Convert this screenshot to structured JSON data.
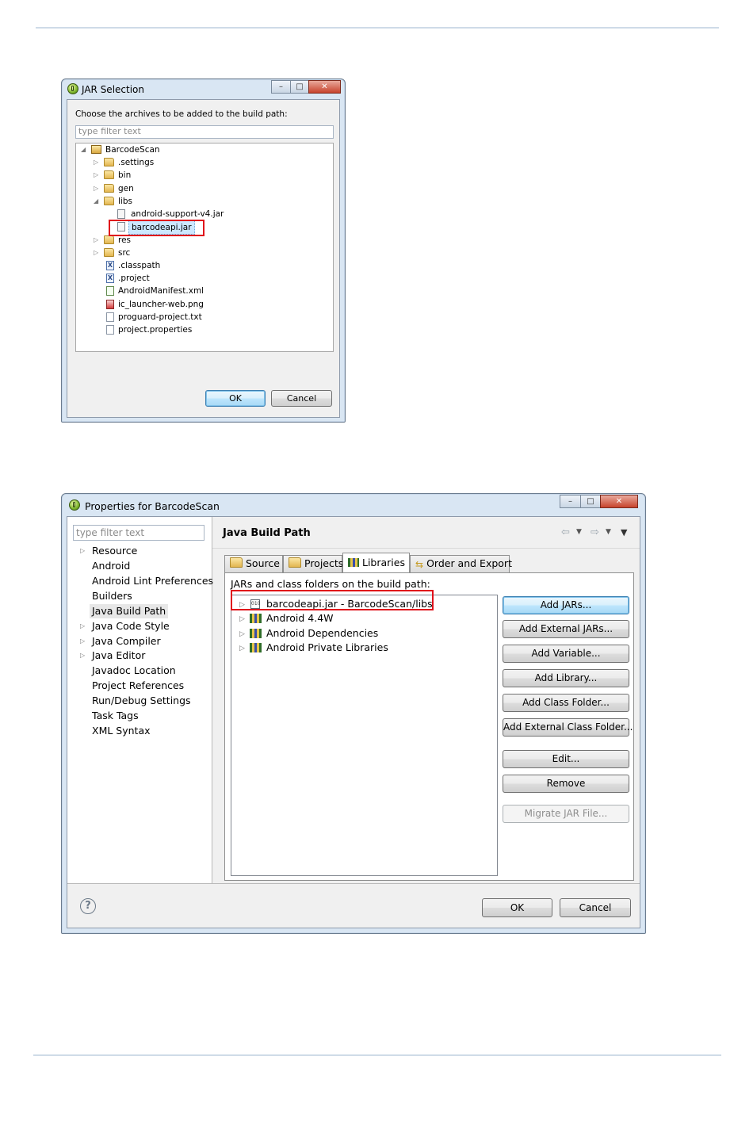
{
  "jar_dialog": {
    "title": "JAR Selection",
    "instruction": "Choose the archives to be added to the build path:",
    "filter_placeholder": "type filter text",
    "tree": {
      "root": "BarcodeScan",
      "settings": ".settings",
      "bin": "bin",
      "gen": "gen",
      "libs": "libs",
      "support_jar": "android-support-v4.jar",
      "barcode_jar": "barcodeapi.jar",
      "res": "res",
      "src": "src",
      "classpath": ".classpath",
      "project": ".project",
      "manifest": "AndroidManifest.xml",
      "launcher": "ic_launcher-web.png",
      "proguard": "proguard-project.txt",
      "properties": "project.properties"
    },
    "ok_label": "OK",
    "cancel_label": "Cancel"
  },
  "props_dialog": {
    "title": "Properties for BarcodeScan",
    "filter_placeholder": "type filter text",
    "nav": {
      "resource": "Resource",
      "android": "Android",
      "lint": "Android Lint Preferences",
      "builders": "Builders",
      "build_path": "Java Build Path",
      "code_style": "Java Code Style",
      "compiler": "Java Compiler",
      "editor": "Java Editor",
      "javadoc": "Javadoc Location",
      "refs": "Project References",
      "rundebug": "Run/Debug Settings",
      "tasktags": "Task Tags",
      "xml": "XML Syntax"
    },
    "page_title": "Java Build Path",
    "tabs": {
      "source": "Source",
      "projects": "Projects",
      "libraries": "Libraries",
      "order": "Order and Export"
    },
    "libs_caption": "JARs and class folders on the build path:",
    "entries": {
      "barcode": "barcodeapi.jar - BarcodeScan/libs",
      "android44": "Android 4.4W",
      "deps": "Android Dependencies",
      "private": "Android Private Libraries"
    },
    "buttons": {
      "add_jars": "Add JARs...",
      "add_external_jars": "Add External JARs...",
      "add_variable": "Add Variable...",
      "add_library": "Add Library...",
      "add_class_folder": "Add Class Folder...",
      "add_external_class_folder": "Add External Class Folder...",
      "edit": "Edit...",
      "remove": "Remove",
      "migrate": "Migrate JAR File..."
    },
    "ok_label": "OK",
    "cancel_label": "Cancel",
    "help_glyph": "?"
  },
  "colors": {
    "highlight_border": "#e0101a",
    "selection_bg": "#cce8ff"
  }
}
